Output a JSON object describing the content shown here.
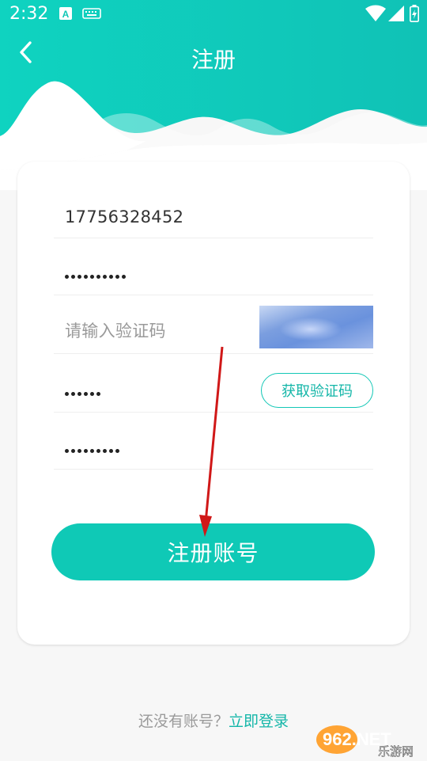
{
  "status_bar": {
    "time": "2:32",
    "icons": [
      "a-notification-icon",
      "keyboard-icon",
      "wifi-icon",
      "signal-icon",
      "battery-icon"
    ]
  },
  "header": {
    "title": "注册",
    "back_icon": "chevron-left-icon",
    "accent_color": "#10cdb9"
  },
  "form": {
    "phone_value": "17756328452",
    "password_dots": 10,
    "captcha_placeholder": "请输入验证码",
    "sms_code_dots": 6,
    "get_code_label": "获取验证码",
    "confirm_password_dots": 9
  },
  "register_button_label": "注册账号",
  "footer": {
    "prompt": "还没有账号？",
    "login_link": "立即登录"
  },
  "watermark": {
    "logo_text": "962.NET",
    "subtitle": "乐游网"
  }
}
